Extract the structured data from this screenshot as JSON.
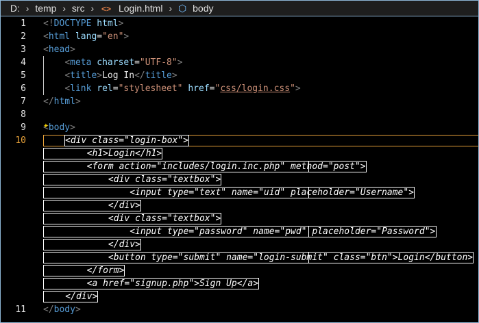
{
  "breadcrumb": {
    "items": [
      "D:",
      "temp",
      "src",
      "Login.html",
      "body"
    ],
    "icons": {
      "file": "html-code-icon",
      "element": "cube-icon"
    }
  },
  "editor": {
    "current_line": "10",
    "lines": [
      {
        "n": "1",
        "tokens": [
          [
            "d",
            "<!"
          ],
          [
            "t",
            "DOCTYPE"
          ],
          [
            "x",
            " "
          ],
          [
            "a",
            "html"
          ],
          [
            "d",
            ">"
          ]
        ]
      },
      {
        "n": "2",
        "tokens": [
          [
            "d",
            "<"
          ],
          [
            "t",
            "html"
          ],
          [
            "x",
            " "
          ],
          [
            "a",
            "lang"
          ],
          [
            "x",
            "="
          ],
          [
            "s",
            "\"en\""
          ],
          [
            "d",
            ">"
          ]
        ]
      },
      {
        "n": "3",
        "tokens": [
          [
            "d",
            "<"
          ],
          [
            "t",
            "head"
          ],
          [
            "d",
            ">"
          ]
        ]
      },
      {
        "n": "4",
        "tokens": [
          [
            "x",
            "    "
          ],
          [
            "d",
            "<"
          ],
          [
            "t",
            "meta"
          ],
          [
            "x",
            " "
          ],
          [
            "a",
            "charset"
          ],
          [
            "x",
            "="
          ],
          [
            "s",
            "\"UTF-8\""
          ],
          [
            "d",
            ">"
          ]
        ]
      },
      {
        "n": "5",
        "tokens": [
          [
            "x",
            "    "
          ],
          [
            "d",
            "<"
          ],
          [
            "t",
            "title"
          ],
          [
            "d",
            ">"
          ],
          [
            "x",
            "Log In"
          ],
          [
            "d",
            "</"
          ],
          [
            "t",
            "title"
          ],
          [
            "d",
            ">"
          ]
        ]
      },
      {
        "n": "6",
        "tokens": [
          [
            "x",
            "    "
          ],
          [
            "d",
            "<"
          ],
          [
            "t",
            "link"
          ],
          [
            "x",
            " "
          ],
          [
            "a",
            "rel"
          ],
          [
            "x",
            "="
          ],
          [
            "s",
            "\"stylesheet\""
          ],
          [
            "x",
            " "
          ],
          [
            "a",
            "href"
          ],
          [
            "x",
            "="
          ],
          [
            "s",
            "\""
          ],
          [
            "u",
            "css/login.css"
          ],
          [
            "s",
            "\""
          ],
          [
            "d",
            ">"
          ]
        ]
      },
      {
        "n": "7",
        "tokens": [
          [
            "d",
            "</"
          ],
          [
            "t",
            "html"
          ],
          [
            "d",
            ">"
          ]
        ]
      },
      {
        "n": "8",
        "tokens": []
      },
      {
        "n": "9",
        "tokens": [
          [
            "d",
            "<"
          ],
          [
            "t",
            "body"
          ],
          [
            "d",
            ">"
          ]
        ]
      }
    ],
    "selected_lines": [
      "    <div class=\"login-box\">",
      "        <h1>Login</h1>",
      "        <form action=\"includes/login.inc.php\" method=\"post\">",
      "            <div class=\"textbox\">",
      "                <input type=\"text\" name=\"uid\" placeholder=\"Username\">",
      "            </div>",
      "            <div class=\"textbox\">",
      "                <input type=\"password\" name=\"pwd\" placeholder=\"Password\">",
      "            </div>",
      "            <button type=\"submit\" name=\"login-submit\" class=\"btn\">Login</button>",
      "        </form>",
      "        <a href=\"signup.php\">Sign Up</a>",
      "    </div>"
    ],
    "last_line": {
      "n": "11",
      "tokens": [
        [
          "d",
          "</"
        ],
        [
          "t",
          "body"
        ],
        [
          "d",
          ">"
        ]
      ]
    }
  }
}
